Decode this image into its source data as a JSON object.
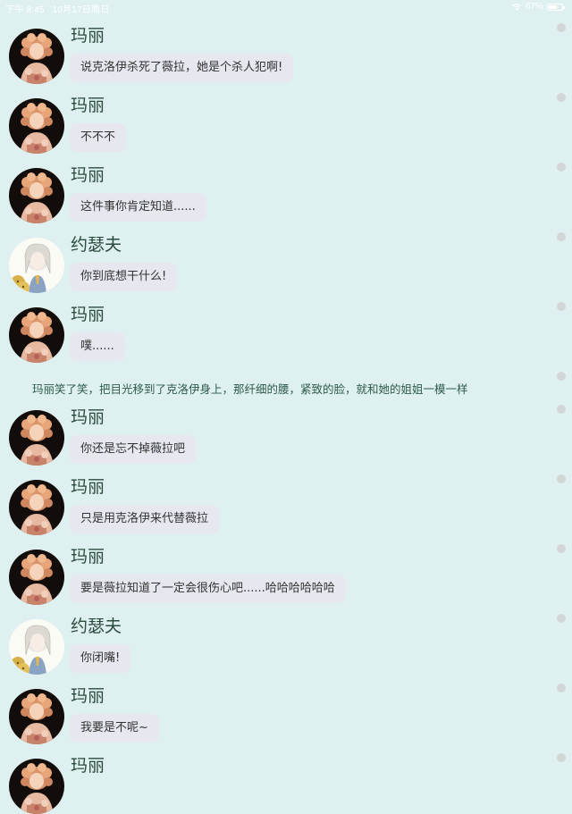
{
  "status_bar": {
    "time": "下午 8:45",
    "date": "10月17日周日",
    "battery": "67%",
    "battery_level": 0.67
  },
  "characters": {
    "mary": "玛丽",
    "joseph": "约瑟夫"
  },
  "messages": [
    {
      "speaker": "玛丽",
      "text": "说克洛伊杀死了薇拉，她是个杀人犯啊!"
    },
    {
      "speaker": "玛丽",
      "text": "不不不"
    },
    {
      "speaker": "玛丽",
      "text": "这件事你肯定知道......"
    },
    {
      "speaker": "约瑟夫",
      "text": "你到底想干什么!"
    },
    {
      "speaker": "玛丽",
      "text": "噗......"
    },
    {
      "narration": "玛丽笑了笑，把目光移到了克洛伊身上，那纤细的腰，紧致的脸，就和她的姐姐一模一样"
    },
    {
      "speaker": "玛丽",
      "text": "你还是忘不掉薇拉吧"
    },
    {
      "speaker": "玛丽",
      "text": "只是用克洛伊来代替薇拉"
    },
    {
      "speaker": "玛丽",
      "text": "要是薇拉知道了一定会很伤心吧......哈哈哈哈哈哈"
    },
    {
      "speaker": "约瑟夫",
      "text": "你闭嘴!"
    },
    {
      "speaker": "玛丽",
      "text": "我要是不呢~"
    },
    {
      "speaker": "玛丽",
      "text": ""
    }
  ],
  "icons": {
    "wifi": "wifi-icon",
    "battery": "battery-icon",
    "avatar_mary": "mary-avatar",
    "avatar_joseph": "joseph-avatar",
    "scroll_dot": "scroll-dot"
  },
  "colors": {
    "background": "#dff0f0",
    "bubble": "#e6e7ef",
    "name": "#2b4a3e",
    "narration": "#2d5a4a"
  }
}
